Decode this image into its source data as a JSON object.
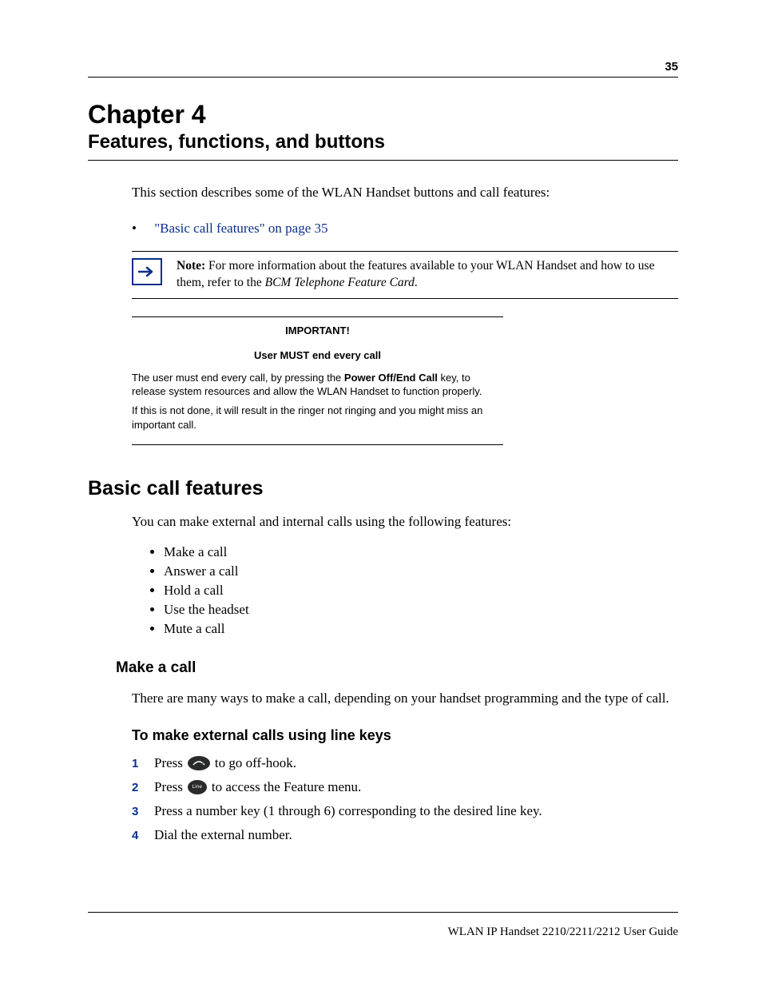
{
  "page_number": "35",
  "chapter": {
    "title": "Chapter 4",
    "subtitle": "Features, functions, and buttons"
  },
  "intro": "This section describes some of the WLAN Handset buttons and call features:",
  "xref": {
    "bullet": "•",
    "text": "\"Basic call features\" on page 35"
  },
  "note": {
    "label": "Note:",
    "body": " For more information about the features available to your WLAN Handset and how to use them, refer to the ",
    "emph": "BCM Telephone Feature Card",
    "tail": "."
  },
  "important": {
    "title": "IMPORTANT!",
    "subtitle": "User MUST end every call",
    "p1a": "The user must end every call, by pressing the ",
    "p1b": "Power Off/End Call",
    "p1c": " key, to release system resources and allow the WLAN Handset to function properly.",
    "p2": "If this is not done, it will result in the ringer not ringing and you might miss an important call."
  },
  "section": {
    "title": "Basic call features",
    "intro": "You can make external and internal calls using the following features:",
    "items": [
      "Make a call",
      "Answer a call",
      "Hold a call",
      "Use the headset",
      "Mute a call"
    ]
  },
  "make_a_call": {
    "title": "Make a call",
    "intro": "There are many ways to make a call, depending on your handset programming and the type of call."
  },
  "external_calls": {
    "title": "To make external calls using line keys",
    "steps": {
      "s1_num": "1",
      "s1a": "Press ",
      "s1b": " to go off-hook.",
      "s2_num": "2",
      "s2a": "Press ",
      "s2b": " to access the Feature menu.",
      "s3_num": "3",
      "s3": "Press a number key (1 through 6) corresponding to the desired line key.",
      "s4_num": "4",
      "s4": "Dial the external number."
    }
  },
  "icon_labels": {
    "line": "Line"
  },
  "footer": "WLAN IP Handset 2210/2211/2212 User Guide"
}
